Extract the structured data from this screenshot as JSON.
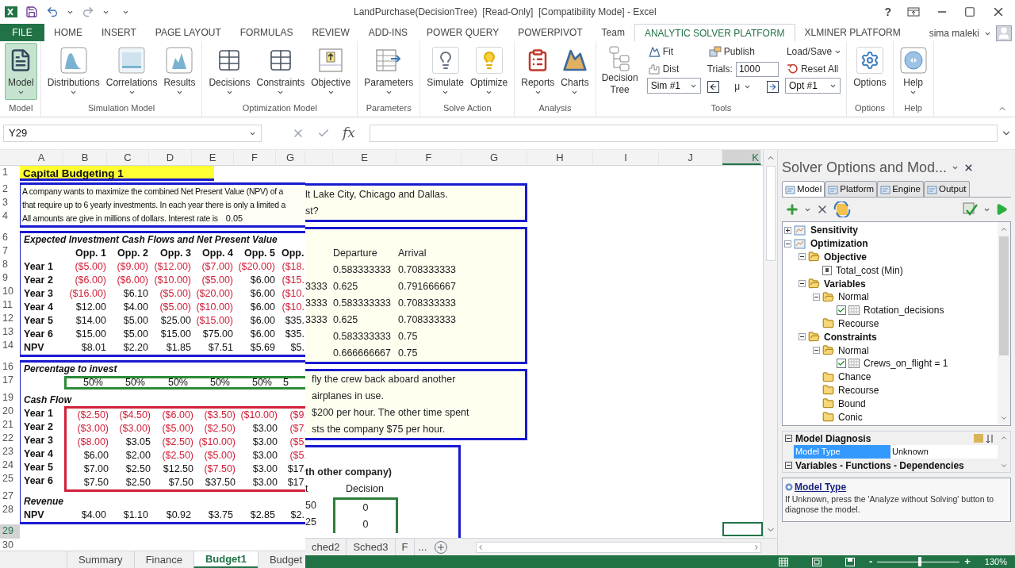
{
  "title_bar": {
    "title": "LandPurchase(DecisionTree)  [Read-Only]  [Compatibility Mode] - Excel",
    "help": "?"
  },
  "ribbon_tabs": [
    {
      "label": "FILE",
      "kind": "file",
      "selected": false
    },
    {
      "label": "HOME",
      "kind": "tab",
      "selected": false
    },
    {
      "label": "INSERT",
      "kind": "tab",
      "selected": false
    },
    {
      "label": "PAGE LAYOUT",
      "kind": "tab",
      "selected": false
    },
    {
      "label": "FORMULAS",
      "kind": "tab",
      "selected": false
    },
    {
      "label": "REVIEW",
      "kind": "tab",
      "selected": false
    },
    {
      "label": "ADD-INS",
      "kind": "tab",
      "selected": false
    },
    {
      "label": "POWER QUERY",
      "kind": "tab",
      "selected": false
    },
    {
      "label": "POWERPIVOT",
      "kind": "tab",
      "selected": false
    },
    {
      "label": "Team",
      "kind": "tab",
      "selected": false
    },
    {
      "label": "ANALYTIC SOLVER PLATFORM",
      "kind": "tab",
      "selected": true
    },
    {
      "label": "XLMINER PLATFORM",
      "kind": "tab",
      "selected": false
    }
  ],
  "user": {
    "name": "sima maleki"
  },
  "ribbon_groups": [
    {
      "label": "Model",
      "kind": "buttons",
      "buttons": [
        {
          "label": "Model",
          "dropdown": true,
          "active": true
        }
      ]
    },
    {
      "label": "Simulation Model",
      "kind": "buttons",
      "buttons": [
        {
          "label": "Distributions",
          "dropdown": true,
          "active": false
        },
        {
          "label": "Correlations",
          "dropdown": true,
          "active": false
        },
        {
          "label": "Results",
          "dropdown": true,
          "active": false
        }
      ]
    },
    {
      "label": "Optimization Model",
      "kind": "buttons",
      "buttons": [
        {
          "label": "Decisions",
          "dropdown": true,
          "active": false
        },
        {
          "label": "Constraints",
          "dropdown": true,
          "active": false
        },
        {
          "label": "Objective",
          "dropdown": true,
          "active": false
        }
      ]
    },
    {
      "label": "Parameters",
      "kind": "buttons",
      "buttons": [
        {
          "label": "Parameters",
          "dropdown": true,
          "active": false
        }
      ]
    },
    {
      "label": "Solve Action",
      "kind": "buttons",
      "buttons": [
        {
          "label": "Simulate",
          "dropdown": true,
          "active": false
        },
        {
          "label": "Optimize",
          "dropdown": true,
          "active": false
        }
      ]
    },
    {
      "label": "Analysis",
      "kind": "buttons",
      "buttons": [
        {
          "label": "Reports",
          "dropdown": true,
          "active": false
        },
        {
          "label": "Charts",
          "dropdown": true,
          "active": false
        }
      ]
    },
    {
      "label": "Tools",
      "kind": "tools",
      "decision_tree": "Decision Tree",
      "fit": "Fit",
      "dist": "Dist",
      "sim_select": "Sim #1",
      "publish": "Publish",
      "trials_label": "Trials:",
      "trials_value": "1000",
      "mu": "μ",
      "load_save": "Load/Save",
      "reset_all": "Reset All",
      "opt_select": "Opt #1"
    },
    {
      "label": "Options",
      "kind": "buttons",
      "buttons": [
        {
          "label": "Options",
          "dropdown": false,
          "active": false
        }
      ]
    },
    {
      "label": "Help",
      "kind": "buttons",
      "buttons": [
        {
          "label": "Help",
          "dropdown": true,
          "active": false
        }
      ]
    }
  ],
  "formula_bar": {
    "name_box": "Y29",
    "fx": "fx"
  },
  "left_sheet": {
    "columns": [
      "A",
      "B",
      "C",
      "D",
      "E",
      "F",
      "G"
    ],
    "title": {
      "number": "1",
      "text": "Capital Budgeting 1"
    },
    "intro": [
      {
        "number": "2",
        "text": "A company wants to maximize the combined Net Present Value (NPV) of a"
      },
      {
        "number": "3",
        "text": "that require up to 6 yearly investments. In each year there is only a limited a"
      },
      {
        "number": "4",
        "text": "All amounts are give in millions of dollars. Interest rate is"
      }
    ],
    "interest_value": "0.05",
    "npv": {
      "heading_number": "6",
      "heading": "Expected Investment Cash Flows and Net Present Value",
      "header": {
        "number": "7",
        "cells": [
          "Opp. 1",
          "Opp. 2",
          "Opp. 3",
          "Opp. 4",
          "Opp. 5",
          "Opp."
        ]
      },
      "rows": [
        {
          "number": "8",
          "label": "Year 1",
          "cells": [
            "($5.00)",
            "($9.00)",
            "($12.00)",
            "($7.00)",
            "($20.00)",
            "($18."
          ],
          "negative": [
            true,
            true,
            true,
            true,
            true,
            true
          ]
        },
        {
          "number": "9",
          "label": "Year 2",
          "cells": [
            "($6.00)",
            "($6.00)",
            "($10.00)",
            "($5.00)",
            "$6.00",
            "($15."
          ],
          "negative": [
            true,
            true,
            true,
            true,
            false,
            true
          ]
        },
        {
          "number": "10",
          "label": "Year 3",
          "cells": [
            "($16.00)",
            "$6.10",
            "($5.00)",
            "($20.00)",
            "$6.00",
            "($10."
          ],
          "negative": [
            true,
            false,
            true,
            true,
            false,
            true
          ]
        },
        {
          "number": "11",
          "label": "Year 4",
          "cells": [
            "$12.00",
            "$4.00",
            "($5.00)",
            "($10.00)",
            "$6.00",
            "($10."
          ],
          "negative": [
            false,
            false,
            true,
            true,
            false,
            true
          ]
        },
        {
          "number": "12",
          "label": "Year 5",
          "cells": [
            "$14.00",
            "$5.00",
            "$25.00",
            "($15.00)",
            "$6.00",
            "$35."
          ],
          "negative": [
            false,
            false,
            false,
            true,
            false,
            false
          ]
        },
        {
          "number": "13",
          "label": "Year 6",
          "cells": [
            "$15.00",
            "$5.00",
            "$15.00",
            "$75.00",
            "$6.00",
            "$35."
          ],
          "negative": [
            false,
            false,
            false,
            false,
            false,
            false
          ]
        },
        {
          "number": "14",
          "label": "NPV",
          "cells": [
            "$8.01",
            "$2.20",
            "$1.85",
            "$7.51",
            "$5.69",
            "$5."
          ],
          "negative": [
            false,
            false,
            false,
            false,
            false,
            false
          ]
        }
      ]
    },
    "percent": {
      "heading_number": "16",
      "heading": "Percentage to invest",
      "number": "17",
      "cells": [
        "50%",
        "50%",
        "50%",
        "50%",
        "50%",
        "5"
      ]
    },
    "cash_flow": {
      "heading_number": "19",
      "heading": "Cash Flow",
      "rows": [
        {
          "number": "20",
          "label": "Year 1",
          "cells": [
            "($2.50)",
            "($4.50)",
            "($6.00)",
            "($3.50)",
            "($10.00)",
            "($9."
          ],
          "negative": [
            true,
            true,
            true,
            true,
            true,
            true
          ]
        },
        {
          "number": "21",
          "label": "Year 2",
          "cells": [
            "($3.00)",
            "($3.00)",
            "($5.00)",
            "($2.50)",
            "$3.00",
            "($7."
          ],
          "negative": [
            true,
            true,
            true,
            true,
            false,
            true
          ]
        },
        {
          "number": "22",
          "label": "Year 3",
          "cells": [
            "($8.00)",
            "$3.05",
            "($2.50)",
            "($10.00)",
            "$3.00",
            "($5."
          ],
          "negative": [
            true,
            false,
            true,
            true,
            false,
            true
          ]
        },
        {
          "number": "23",
          "label": "Year 4",
          "cells": [
            "$6.00",
            "$2.00",
            "($2.50)",
            "($5.00)",
            "$3.00",
            "($5."
          ],
          "negative": [
            false,
            false,
            true,
            true,
            false,
            true
          ]
        },
        {
          "number": "24",
          "label": "Year 5",
          "cells": [
            "$7.00",
            "$2.50",
            "$12.50",
            "($7.50)",
            "$3.00",
            "$17."
          ],
          "negative": [
            false,
            false,
            false,
            true,
            false,
            false
          ]
        },
        {
          "number": "25",
          "label": "Year 6",
          "cells": [
            "$7.50",
            "$2.50",
            "$7.50",
            "$37.50",
            "$3.00",
            "$17."
          ],
          "negative": [
            false,
            false,
            false,
            false,
            false,
            false
          ]
        }
      ]
    },
    "revenue": {
      "heading_number": "27",
      "heading": "Revenue",
      "row": {
        "number": "28",
        "label": "NPV",
        "cells": [
          "$4.00",
          "$1.10",
          "$0.92",
          "$3.75",
          "$2.85",
          "$2."
        ],
        "negative": [
          false,
          false,
          false,
          false,
          false,
          false
        ]
      }
    },
    "extra_rows": [
      {
        "number": "29",
        "selected": true
      },
      {
        "number": "30",
        "selected": false
      }
    ]
  },
  "left_sheet_tabs": [
    {
      "label": "Summary",
      "selected": false
    },
    {
      "label": "Finance",
      "selected": false
    },
    {
      "label": "Budget1",
      "selected": true
    },
    {
      "label": "Budget",
      "selected": false
    }
  ],
  "right_sheet": {
    "columns": [
      {
        "label": "E",
        "selected": false
      },
      {
        "label": "F",
        "selected": false
      },
      {
        "label": "G",
        "selected": false
      },
      {
        "label": "H",
        "selected": false
      },
      {
        "label": "I",
        "selected": false
      },
      {
        "label": "J",
        "selected": false
      },
      {
        "label": "K",
        "selected": true
      }
    ],
    "intro_lines": [
      "lt Lake City, Chicago and Dallas.",
      "st?"
    ],
    "times": {
      "header": [
        "Departure",
        "Arrival"
      ],
      "rows": [
        [
          "",
          "0.583333333",
          "0.708333333"
        ],
        [
          "3333",
          "0.625",
          "0.791666667"
        ],
        [
          "3333",
          "0.583333333",
          "0.708333333"
        ],
        [
          "3333",
          "0.625",
          "0.708333333"
        ],
        [
          "",
          "0.583333333",
          "0.75"
        ],
        [
          "",
          "0.666666667",
          "0.75"
        ]
      ]
    },
    "notes": [
      "fly the crew back aboard another",
      "airplanes in use.",
      "$200 per hour. The other time spent",
      "sts the company $75 per hour."
    ],
    "decision": {
      "heading": "th other company)",
      "header": [
        "t",
        "Decision"
      ],
      "rows": [
        [
          "50",
          "0"
        ],
        [
          "25",
          "0"
        ]
      ]
    }
  },
  "right_sheet_tabs": [
    {
      "label": "ched2",
      "selected": false
    },
    {
      "label": "Sched3",
      "selected": false
    },
    {
      "label": "F",
      "selected": false
    }
  ],
  "more_tabs": "...",
  "status_bar": {
    "zoom_out": "-",
    "zoom_in": "+",
    "zoom": "130%",
    "zoom_slider": {
      "level": 0.52
    }
  },
  "solver_pane": {
    "title": "Solver Options and Mod...",
    "tabs": [
      {
        "label": "Model",
        "selected": true
      },
      {
        "label": "Platform",
        "selected": false
      },
      {
        "label": "Engine",
        "selected": false
      },
      {
        "label": "Output",
        "selected": false
      }
    ],
    "tree": [
      {
        "label": "Sensitivity",
        "kind": "group",
        "expanded": false
      },
      {
        "label": "Optimization",
        "kind": "group",
        "expanded": true,
        "children": [
          {
            "label": "Objective",
            "kind": "folder",
            "expanded": true,
            "children": [
              {
                "label": "Total_cost (Min)",
                "kind": "cell"
              }
            ]
          },
          {
            "label": "Variables",
            "kind": "folder",
            "expanded": true,
            "children": [
              {
                "label": "Normal",
                "kind": "folder",
                "expanded": true,
                "children": [
                  {
                    "label": "Rotation_decisions",
                    "kind": "range",
                    "checked": true
                  }
                ]
              },
              {
                "label": "Recourse",
                "kind": "folder"
              }
            ]
          },
          {
            "label": "Constraints",
            "kind": "folder",
            "expanded": true,
            "children": [
              {
                "label": "Normal",
                "kind": "folder",
                "expanded": true,
                "children": [
                  {
                    "label": "Crews_on_flight = 1",
                    "kind": "range",
                    "checked": true
                  }
                ]
              },
              {
                "label": "Chance",
                "kind": "folder"
              },
              {
                "label": "Recourse",
                "kind": "folder"
              },
              {
                "label": "Bound",
                "kind": "folder"
              },
              {
                "label": "Conic",
                "kind": "folder"
              }
            ]
          }
        ]
      }
    ],
    "properties": [
      {
        "label": "Model Diagnosis",
        "expanded": true,
        "rows": [
          {
            "name": "Model Type",
            "value": "Unknown",
            "selected": true
          }
        ]
      },
      {
        "label": "Variables - Functions - Dependencies",
        "expanded": true
      }
    ],
    "help": {
      "title": "Model Type",
      "text": "If Unknown, press the 'Analyze without Solving' button to diagnose the model."
    }
  }
}
